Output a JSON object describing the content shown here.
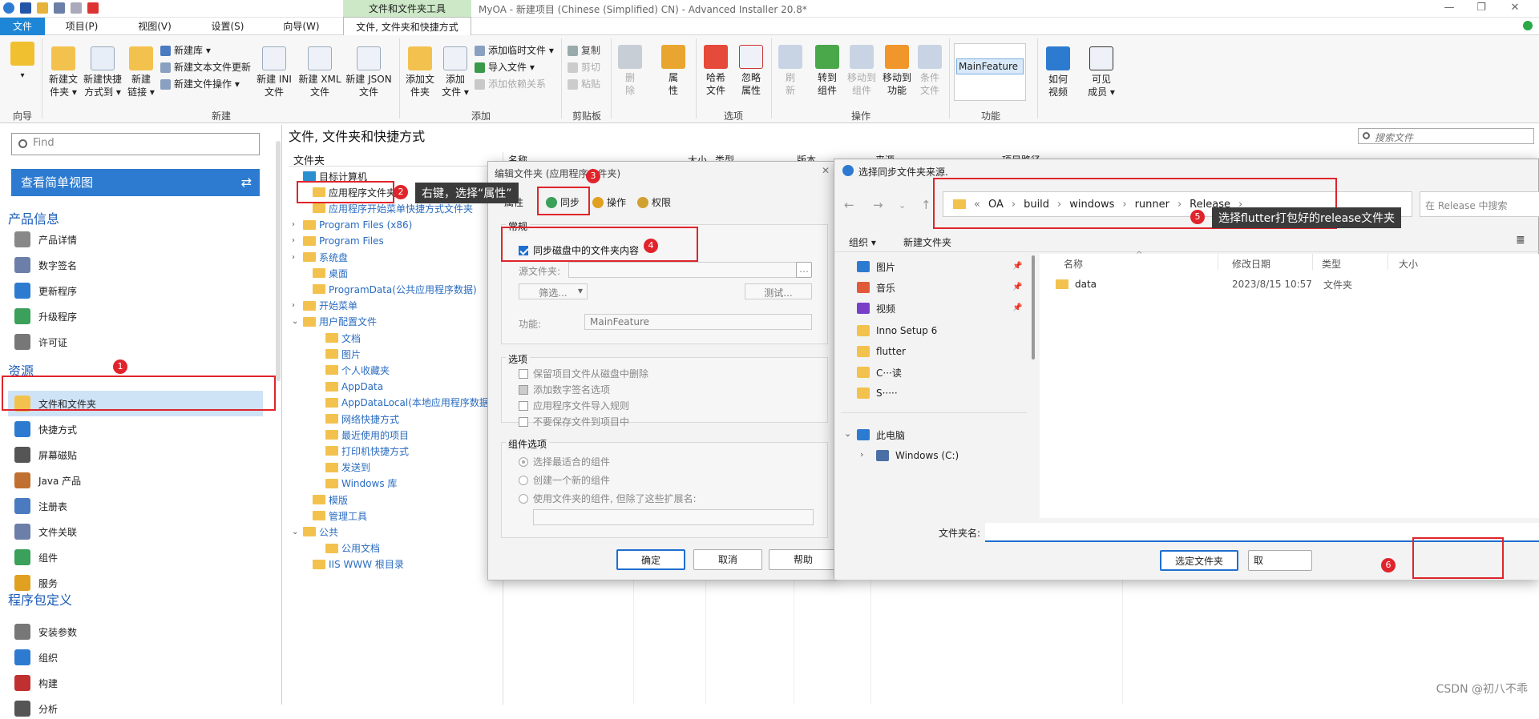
{
  "app": {
    "window_title": "MyOA - 新建项目 (Chinese (Simplified) CN) - Advanced Installer 20.8*",
    "context_tab_group": "文件和文件夹工具",
    "window_controls": [
      "—",
      "❐",
      "✕"
    ]
  },
  "tabs": [
    "文件",
    "项目(P)",
    "视图(V)",
    "设置(S)",
    "向导(W)",
    "文件, 文件夹和快捷方式"
  ],
  "ribbon": {
    "wizard_group": "向导",
    "new_group": "新建",
    "add_group": "添加",
    "clipboard_group": "剪贴板",
    "options_group": "选项",
    "operations_group": "操作",
    "feature_group": "功能",
    "new_file_link": [
      "新建文",
      "件夹 ▾"
    ],
    "new_shortcut": [
      "新建快捷",
      "方式到 ▾"
    ],
    "new_link": [
      "新建",
      "链接 ▾"
    ],
    "new_lib": "新建库 ▾",
    "new_text_update": "新建文本文件更新",
    "new_file_op": "新建文件操作 ▾",
    "new_ini": [
      "新建 INI",
      "文件"
    ],
    "new_xml": [
      "新建 XML",
      "文件"
    ],
    "new_json": [
      "新建 JSON",
      "文件"
    ],
    "add_folder": [
      "添加文",
      "件夹"
    ],
    "add_file": [
      "添加",
      "文件 ▾"
    ],
    "add_temp": "添加临时文件 ▾",
    "import_file": "导入文件 ▾",
    "add_dep": "添加依赖关系",
    "copy": "复制",
    "cut": "剪切",
    "paste": "粘贴",
    "delete": [
      "删",
      "除"
    ],
    "properties": [
      "属",
      "性"
    ],
    "hash_file": [
      "哈希",
      "文件"
    ],
    "ignore_attr": [
      "忽略",
      "属性"
    ],
    "refresh": [
      "刷",
      "新"
    ],
    "goto_component": [
      "转到",
      "组件"
    ],
    "move_to_component": [
      "移动到",
      "组件"
    ],
    "move_to_feature": [
      "移动到",
      "功能"
    ],
    "cond_file": [
      "条件",
      "文件"
    ],
    "feature_value": "MainFeature",
    "how_to_video": [
      "如何",
      "视频"
    ],
    "visible_members": [
      "可见",
      "成员 ▾"
    ]
  },
  "left": {
    "find_placeholder": "Find",
    "simple_view": "查看简单视图",
    "sections": [
      "产品信息",
      "资源",
      "程序包定义"
    ],
    "product_items": [
      "产品详情",
      "数字签名",
      "更新程序",
      "升级程序",
      "许可证"
    ],
    "resource_items": [
      "文件和文件夹",
      "快捷方式",
      "屏幕磁贴",
      "Java 产品",
      "注册表",
      "文件关联",
      "组件",
      "服务"
    ],
    "package_items": [
      "安装参数",
      "组织",
      "构建",
      "分析"
    ]
  },
  "main": {
    "header": "文件, 文件夹和快捷方式",
    "search_placeholder": "搜索文件",
    "folders_header": "文件夹",
    "tree": [
      {
        "label": "目标计算机",
        "expand": "",
        "dark": true
      },
      {
        "label": "应用程序文件夹",
        "expand": "",
        "dark": true
      },
      {
        "label": "应用程序开始菜单快捷方式文件夹",
        "expand": ""
      },
      {
        "label": "Program Files (x86)",
        "expand": "›"
      },
      {
        "label": "Program Files",
        "expand": "›"
      },
      {
        "label": "系统盘",
        "expand": "›"
      },
      {
        "label": "桌面",
        "expand": ""
      },
      {
        "label": "ProgramData(公共应用程序数据)",
        "expand": ""
      },
      {
        "label": "开始菜单",
        "expand": "›"
      },
      {
        "label": "用户配置文件",
        "expand": "⌄"
      },
      {
        "label": "文档",
        "expand": ""
      },
      {
        "label": "图片",
        "expand": ""
      },
      {
        "label": "个人收藏夹",
        "expand": ""
      },
      {
        "label": "AppData",
        "expand": ""
      },
      {
        "label": "AppDataLocal(本地应用程序数据)",
        "expand": ""
      },
      {
        "label": "网络快捷方式",
        "expand": ""
      },
      {
        "label": "最近使用的项目",
        "expand": ""
      },
      {
        "label": "打印机快捷方式",
        "expand": ""
      },
      {
        "label": "发送到",
        "expand": ""
      },
      {
        "label": "Windows 库",
        "expand": ""
      },
      {
        "label": "模版",
        "expand": ""
      },
      {
        "label": "管理工具",
        "expand": ""
      },
      {
        "label": "公共",
        "expand": "⌄"
      },
      {
        "label": "公用文档",
        "expand": ""
      },
      {
        "label": "IIS WWW 根目录",
        "expand": ""
      }
    ],
    "columns": [
      "名称",
      "大小",
      "类型",
      "版本",
      "来源",
      "项目路径"
    ]
  },
  "annotations": {
    "b1": "1",
    "b2": "2",
    "b3": "3",
    "b4": "4",
    "b5": "5",
    "b6": "6",
    "callout2": "右键，选择“属性”",
    "callout5": "选择flutter打包好的release文件夹"
  },
  "dialog1": {
    "title": "编辑文件夹 (应用程序文件夹)",
    "tab_props": "属性",
    "tab_sync": "同步",
    "tab_ops": "操作",
    "tab_perm": "权限",
    "general": "常规",
    "sync_checkbox": "同步磁盘中的文件夹内容",
    "source_folder": "源文件夹:",
    "filter": "筛选...",
    "test": "测试...",
    "feature_label": "功能:",
    "feature_value": "MainFeature",
    "options": "选项",
    "opt1": "保留项目文件从磁盘中删除",
    "opt2": "添加数字签名选项",
    "opt3": "应用程序文件导入规则",
    "opt4": "不要保存文件到项目中",
    "comp_options": "组件选项",
    "radio1": "选择最适合的组件",
    "radio2": "创建一个新的组件",
    "radio3": "使用文件夹的组件, 但除了这些扩展名:",
    "ok": "确定",
    "cancel": "取消",
    "help": "帮助"
  },
  "dialog2": {
    "title": "选择同步文件夹来源.",
    "path": [
      "«",
      "OA",
      "›",
      "build",
      "›",
      "windows",
      "›",
      "runner",
      "›",
      "Release",
      "›"
    ],
    "search_placeholder": "在 Release 中搜索",
    "organize": "组织 ▾",
    "new_folder": "新建文件夹",
    "nav": [
      {
        "label": "图片",
        "color": "#2d7bd0",
        "pin": true
      },
      {
        "label": "音乐",
        "color": "#e05a3a",
        "pin": true
      },
      {
        "label": "视频",
        "color": "#7a3fc7",
        "pin": true
      },
      {
        "label": "Inno Setup 6",
        "color": "#f3c24e",
        "pin": false
      },
      {
        "label": "flutter",
        "color": "#f3c24e",
        "pin": false
      },
      {
        "label": "C···读",
        "color": "#f3c24e",
        "pin": false
      },
      {
        "label": "S·····",
        "color": "#f3c24e",
        "pin": false
      },
      {
        "label": "此电脑",
        "color": "#2d7bd0",
        "pin": false
      },
      {
        "label": "Windows (C:)",
        "color": "#4a6fa5",
        "pin": false
      }
    ],
    "cols": [
      "名称",
      "修改日期",
      "类型",
      "大小"
    ],
    "file": {
      "name": "data",
      "date": "2023/8/15 10:57",
      "type": "文件夹"
    },
    "filename_label": "文件夹名:",
    "select_btn": "选定文件夹",
    "cancel_btn": "取"
  },
  "watermark": "CSDN @初八不乖"
}
